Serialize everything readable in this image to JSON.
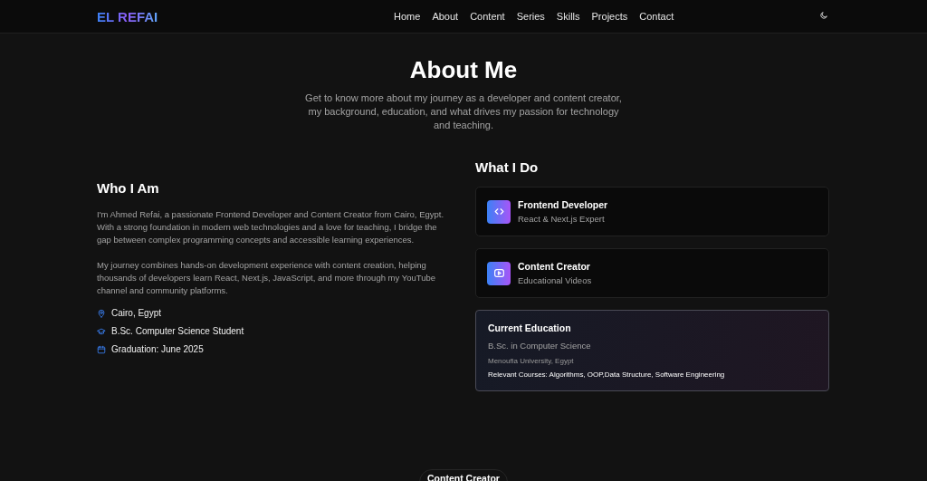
{
  "header": {
    "logo": "EL REFAI",
    "nav": [
      {
        "label": "Home"
      },
      {
        "label": "About"
      },
      {
        "label": "Content"
      },
      {
        "label": "Series"
      },
      {
        "label": "Skills"
      },
      {
        "label": "Projects"
      },
      {
        "label": "Contact"
      }
    ]
  },
  "hero": {
    "title": "About Me",
    "subtitle": "Get to know more about my journey as a developer and content creator, my background, education, and what drives my passion for technology and teaching."
  },
  "who": {
    "title": "Who I Am",
    "paragraphs": [
      "I'm Ahmed Refai, a passionate Frontend Developer and Content Creator from Cairo, Egypt. With a strong foundation in modern web technologies and a love for teaching, I bridge the gap between complex programming concepts and accessible learning experiences.",
      "My journey combines hands-on development experience with content creation, helping thousands of developers learn React, Next.js, JavaScript, and more through my YouTube channel and community platforms."
    ],
    "facts": [
      {
        "kind": "location",
        "text": "Cairo, Egypt"
      },
      {
        "kind": "degree",
        "text": "B.Sc. Computer Science Student"
      },
      {
        "kind": "date",
        "text": "Graduation: June 2025"
      }
    ]
  },
  "what": {
    "title": "What I Do",
    "roles": [
      {
        "kind": "code",
        "title": "Frontend Developer",
        "subtitle": "React & Next.js Expert"
      },
      {
        "kind": "video",
        "title": "Content Creator",
        "subtitle": "Educational Videos"
      }
    ],
    "education": {
      "title": "Current Education",
      "degree": "B.Sc. in Computer Science",
      "school": "Menoufia University, Egypt",
      "courses": "Relevant Courses: Algorithms, OOP,Data Structure, Software Engineering"
    }
  },
  "next_section": {
    "label": "Content Creator"
  }
}
